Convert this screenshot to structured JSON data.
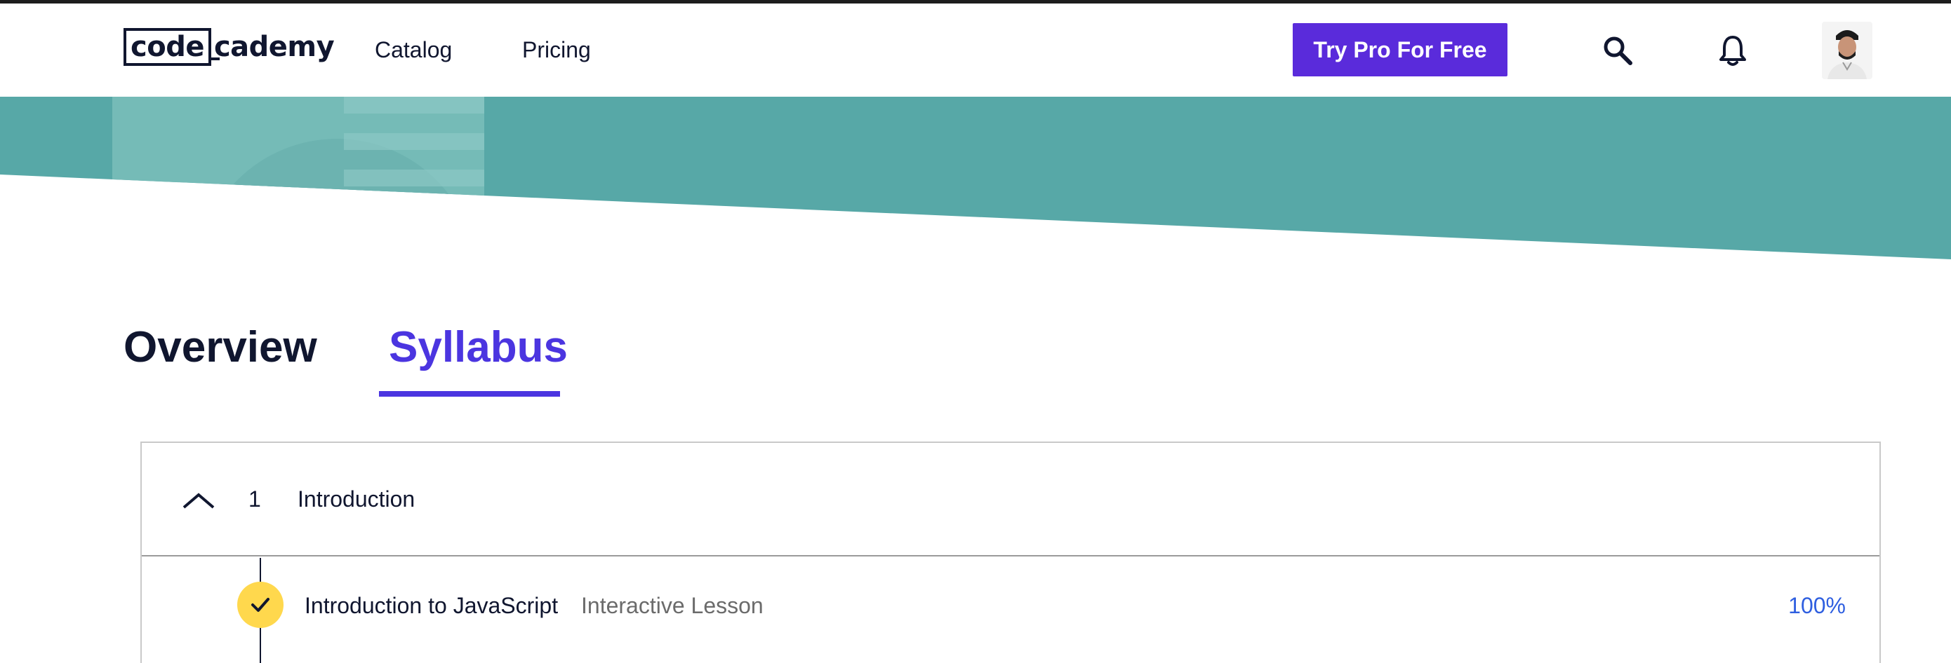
{
  "header": {
    "logo_left": "code",
    "logo_right": "cademy",
    "nav": {
      "catalog": "Catalog",
      "pricing": "Pricing"
    },
    "cta_label": "Try Pro For Free",
    "icons": {
      "search": "search-icon",
      "notifications": "bell-icon",
      "profile": "avatar"
    }
  },
  "tabs": {
    "overview": "Overview",
    "syllabus": "Syllabus",
    "active": "syllabus"
  },
  "syllabus": {
    "modules": [
      {
        "number": "1",
        "title": "Introduction",
        "expanded": true,
        "lessons": [
          {
            "title": "Introduction to JavaScript",
            "type": "Interactive Lesson",
            "progress": "100%",
            "completed": true
          }
        ]
      }
    ]
  },
  "colors": {
    "brand_purple": "#5a2bdb",
    "tab_active": "#4b35e0",
    "hero_teal": "#57a8a7",
    "check_yellow": "#ffd84d",
    "progress_blue": "#2f5fe0",
    "text_dark": "#10162f"
  }
}
